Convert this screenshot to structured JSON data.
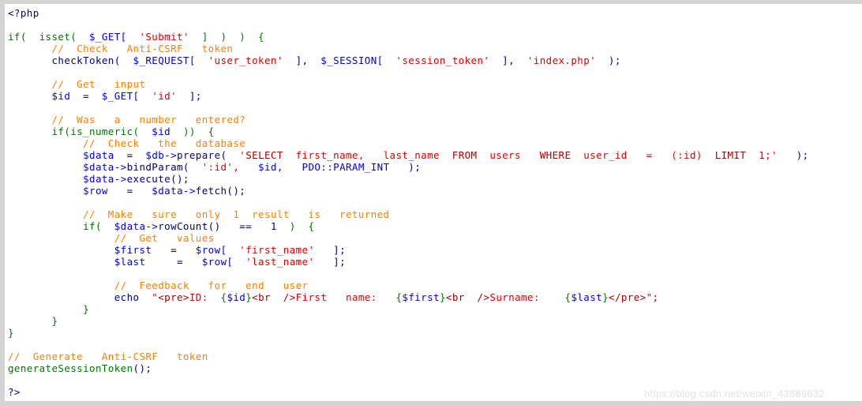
{
  "window": {
    "background_color": "#d4d4d4",
    "code_background": "#ffffff"
  },
  "watermark": {
    "text": "https://blog.csdn.net/weixin_43886632",
    "color": "#e2e2e2"
  },
  "palette": {
    "php_tag": "#00008b",
    "variable": "#0000ee",
    "function": "#007700",
    "comment": "#ff8000",
    "string": "#dd0000",
    "sql_keyword": "#aa0000",
    "html_tag": "#aa0000",
    "plain": "#000080"
  },
  "code": {
    "language": "php",
    "line_count": 33,
    "lines": [
      {
        "n": 1,
        "text": "<?php"
      },
      {
        "n": 2,
        "text": ""
      },
      {
        "n": 3,
        "text": "if( isset( $_GET[ 'Submit' ] ) ) {"
      },
      {
        "n": 4,
        "text": "    // Check Anti-CSRF token"
      },
      {
        "n": 5,
        "text": "    checkToken( $_REQUEST[ 'user_token' ], $_SESSION[ 'session_token' ], 'index.php' );"
      },
      {
        "n": 6,
        "text": ""
      },
      {
        "n": 7,
        "text": "    // Get input"
      },
      {
        "n": 8,
        "text": "    $id = $_GET[ 'id' ];"
      },
      {
        "n": 9,
        "text": ""
      },
      {
        "n": 10,
        "text": "    // Was a number entered?"
      },
      {
        "n": 11,
        "text": "    if(is_numeric( $id )) {"
      },
      {
        "n": 12,
        "text": "        // Check the database"
      },
      {
        "n": 13,
        "text": "        $data = $db->prepare( 'SELECT first_name, last_name FROM users WHERE user_id = (:id) LIMIT 1;' );"
      },
      {
        "n": 14,
        "text": "        $data->bindParam( ':id', $id, PDO::PARAM_INT );"
      },
      {
        "n": 15,
        "text": "        $data->execute();"
      },
      {
        "n": 16,
        "text": "        $row = $data->fetch();"
      },
      {
        "n": 17,
        "text": ""
      },
      {
        "n": 18,
        "text": "        // Make sure only 1 result is returned"
      },
      {
        "n": 19,
        "text": "        if( $data->rowCount() == 1 ) {"
      },
      {
        "n": 20,
        "text": "            // Get values"
      },
      {
        "n": 21,
        "text": "            $first = $row[ 'first_name' ];"
      },
      {
        "n": 22,
        "text": "            $last  = $row[ 'last_name' ];"
      },
      {
        "n": 23,
        "text": ""
      },
      {
        "n": 24,
        "text": "            // Feedback for end user"
      },
      {
        "n": 25,
        "text": "            echo \"<pre>ID: {$id}<br />First name: {$first}<br />Surname: {$last}</pre>\";"
      },
      {
        "n": 26,
        "text": "        }"
      },
      {
        "n": 27,
        "text": "    }"
      },
      {
        "n": 28,
        "text": "}"
      },
      {
        "n": 29,
        "text": ""
      },
      {
        "n": 30,
        "text": "// Generate Anti-CSRF token"
      },
      {
        "n": 31,
        "text": "generateSessionToken();"
      },
      {
        "n": 32,
        "text": ""
      },
      {
        "n": 33,
        "text": "?>"
      }
    ]
  }
}
